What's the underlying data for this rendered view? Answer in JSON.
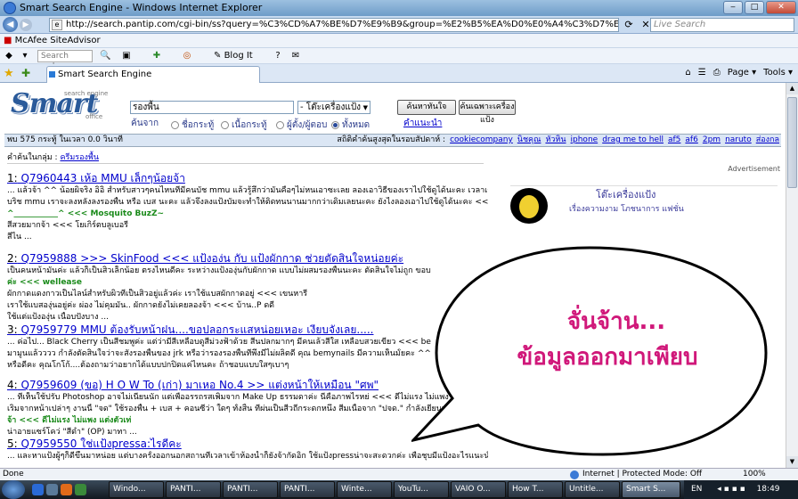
{
  "window": {
    "title": "Smart Search Engine - Windows Internet Explorer"
  },
  "addressbar": {
    "url": "http://search.pantip.com/cgi-bin/ss?query=%C3%CD%A7%BE%D7%E9%B9&group=%E2%B5%EA%D0%E0%A4%C3%D7%E8%CD%A7%E1%BB%E9%A7&grp=&se",
    "live_search_placeholder": "Live Search"
  },
  "mcafee": {
    "label": "McAfee SiteAdvisor"
  },
  "toolbar": {
    "search_placeholder": "Search web...",
    "blog_it": "Blog It"
  },
  "tab": {
    "title": "Smart Search Engine"
  },
  "right_tools": {
    "page": "Page ▾",
    "tools": "Tools ▾"
  },
  "logo": {
    "main": "Smart",
    "top": "search engine",
    "bottom": "office"
  },
  "search": {
    "query": "รองพื้น",
    "group_select": "- โต๊ะเครื่องแป้ง",
    "btn_search": "ค้นหาทันใจ",
    "btn_advanced": "ค้นเฉพาะเครื่องแป้ง",
    "search_from_label": "ค้นจาก",
    "radio_title": "ชื่อกระทู้",
    "radio_content": "เนื้อกระทู้",
    "radio_author": "ผู้ตั้ง/ผู้ตอบ",
    "radio_all": "ทั้งหมด",
    "advice_link": "คำแนะนำ"
  },
  "stats": {
    "found": "พบ 575 กระทู้ ในเวลา 0.0 วินาที",
    "popular_label": "สถิติคำค้นสูงสุดในรอบสัปดาห์ :",
    "keywords": [
      "cookiecompany",
      "นิชคุณ",
      "หัวหิน",
      "iphone",
      "drag me to hell",
      "af5",
      "af6",
      "2pm",
      "naruto",
      "ส่องกล"
    ]
  },
  "group_line": {
    "label": "คำค้นในกลุ่ม :",
    "link": "ครีมรองพื้น"
  },
  "advertisement_label": "Advertisement",
  "results": [
    {
      "num": "1:",
      "link": "Q7960443 เห้อ MMU เล็กๆน้อยจ้า",
      "lines": [
        "... แล้วจ้า ^^ น้อยผิจริง อิอิ สำหรับสาวๆคนไหนที่มีคนบัช mmu แล้วรู้สึกว่ามันคือๆไม่หนเอาซะเลย ลองเอาวิธีของเราไปใช้ดูได้นะคะ เวลาเรามีด",
        "บริช mmu เราจะลงหลังลงรองพื้น หรือ เบส นะคะ แล้วจึงลงแป้งบัมจะทำให้ติดทนนานมากกว่าเดิมเลยนะคะ ยังไงลองเอาไปใช้ดูได้นะคะ <<< ซี่ สซี่",
        "^___________^ <<< Mosquito BuzZ~",
        "สีสวยมากจ้า <<< โยเกิร์ตบลูเบอรี่",
        "สีไน ..."
      ]
    },
    {
      "num": "2:",
      "link": "Q7959888 >>> SkinFood <<< แป้งอง่น กับ แป้งผักกาด ช่วยตัดสินใจหน่อยค่ะ",
      "lines": [
        "เป็นคนหน้ามันค่ะ แล้วก็เป็นสิวเล็กน้อย ตรงไหนดีคะ ระหว่างแป้งองุ่นกับผักกาด แบบไม่ผสมรองพื้นนะคะ ตัดสินใจไม่ถูก ขอบ",
        "ค่ะ <<< wellease",
        "ผักกาดแดงกาวเป็นไลน์สำหรับผิวที่เป็นสิวอยู่แล้วค่ะ เราใช้แบสผักกาดอยู่ <<< เขนหารี",
        "เราใช้แบสองุ่นอยู่ค่ะ ผ่อง ไม่คุมมัน.. ผักกาดยังไม่เคยลองจ้า <<< บ้าน..P ดดี",
        "ใช้แต่แป้งองุ่น เนื้อบปังบาง ..."
      ]
    },
    {
      "num": "3:",
      "link": "Q7959779 MMU ต้องรับหน้าฝน....ขอปลอกระแสหน่อยเหอะ เงียบจังเลย.....",
      "lines": [
        "... ค่อไป... Black Cherry เป็นสีชมพูค่ะ แต่ว่ามีสีเหลือบดูสีม่วงฟ้าด้วย สีนปลกมากๆ มีคนเล้วสีใส เหลือบสวยเขียว <<< be",
        "มามูนแล้วววว กำลังตัดสินใจว่าจะสั่งรองพื้นของ jrk หรือว่ารองรองพื้นที่พึ่งมี่ไม่ผลิตดี คุณ bemynails มีความเห็นมั้ยคะ ^^",
        "หรือดีคะ คุณโกโก้....ต้องถามว่าอยากได้แบบปกปิดแค่ไหนคะ ถ้าชอบแบบใสๆเบาๆ"
      ]
    },
    {
      "num": "4:",
      "link": "Q7959609 (ขอ) H O W To (เก่า) มาเหอ No.4 >> แต่งหน้าให้เหมือน \"ศพ\"",
      "lines": [
        "... ที่เห็นใช้ปรับ Photoshop อาจไม่เนียนนัก แต่เพื่ออรรถรสเพิ่มจาก Make Up ธรรมดาค่ะ นี่คือภาพไรหย่ <<< ดีไม่แรง ไม่แพง แต่งตัวเท่",
        "เริ่มจากหน้าเปล่าๆ งานนี้ \"จด\" ใช้รองพื้น + เบส + คอนซีว่า ใดๆ ทั้งสิ้น ที่ผ่นเป็นสีวถีกระดกหนึ่ง สีมเนื้อจาก \"ปจด.\" กำลังเยียนเยือน",
        "จ้า <<< ดีไม่แรง ไม่แพง แต่งตัวเท่",
        "น่าอายแซร์โคว่ \"สีดำ\" (OP) มาทา ..."
      ]
    },
    {
      "num": "5:",
      "link": "Q7959550 ใช่แป้งpressa:ไรดีคะ",
      "lines": [
        "... และหาแป้งผู้ๆก็ดีขึ้นมาหน่อย แต่บางครั้งออกนอกสถานที่เวลาเข้าห้องน้ำก็ยังจ้ากัดอิก ใช้แป้งpressน่าจะสะดวกค่ะ เพื่อชุบมีแป้งอะไรแนะนำ"
      ]
    }
  ],
  "ad": {
    "title": "โต๊ะเครื่องแป้ง",
    "subtitle": "เรื่องความงาม โภชนาการ แฟชั่น"
  },
  "bubble": {
    "line1": "จั่นจ้าน...",
    "line2": "ข้อมูลออกมาเพียบ"
  },
  "status": {
    "done": "Done",
    "zone": "Internet | Protected Mode: Off",
    "zoom": "100%"
  },
  "taskbar": {
    "items": [
      "Windo...",
      "PANTI...",
      "PANTI...",
      "PANTI...",
      "Winte...",
      "YouTu...",
      "VAIO O...",
      "How T...",
      "Untitle...",
      "Smart S..."
    ],
    "lang": "EN",
    "clock": "18:49"
  }
}
